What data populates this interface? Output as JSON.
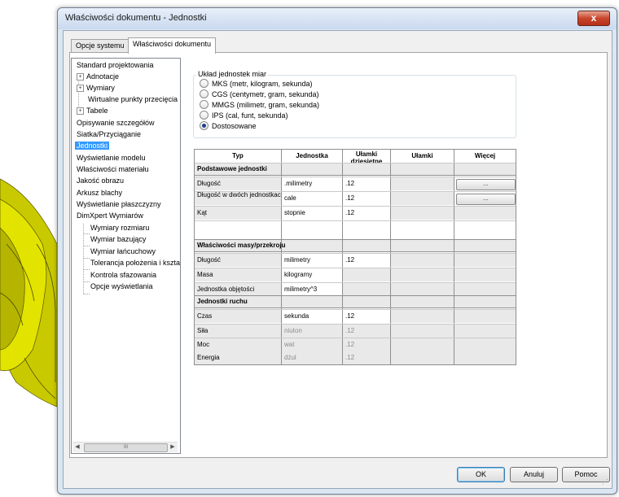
{
  "window": {
    "title": "Właściwości dokumentu - Jednostki",
    "close_label": "x"
  },
  "tabs": [
    {
      "label": "Opcje systemu"
    },
    {
      "label": "Właściwości dokumentu"
    }
  ],
  "tree": {
    "items": [
      {
        "label": "Standard projektowania"
      },
      {
        "label": "Adnotacje"
      },
      {
        "label": "Wymiary"
      },
      {
        "label": "Wirtualne punkty przecięcia"
      },
      {
        "label": "Tabele"
      },
      {
        "label": "Opisywanie szczegółów"
      },
      {
        "label": "Siatka/Przyciąganie"
      },
      {
        "label": "Jednostki"
      },
      {
        "label": "Wyświetlanie modelu"
      },
      {
        "label": "Właściwości materiału"
      },
      {
        "label": "Jakość obrazu"
      },
      {
        "label": "Arkusz blachy"
      },
      {
        "label": "Wyświetlanie płaszczyzny"
      },
      {
        "label": "DimXpert Wymiarów"
      },
      {
        "label": "Wymiary rozmiaru"
      },
      {
        "label": "Wymiar bazujący"
      },
      {
        "label": "Wymiar łańcuchowy"
      },
      {
        "label": "Tolerancja położenia i kształtu"
      },
      {
        "label": "Kontrola sfazowania"
      },
      {
        "label": "Opcje wyświetlania"
      }
    ],
    "scroll_thumb": "III"
  },
  "unit_system": {
    "title": "Układ jednostek miar",
    "options": [
      {
        "label": "MKS  (metr, kilogram, sekunda)"
      },
      {
        "label": "CGS  (centymetr, gram, sekunda)"
      },
      {
        "label": "MMGS  (milimetr, gram, sekunda)"
      },
      {
        "label": "IPS  (cal, funt, sekunda)"
      },
      {
        "label": "Dostosowane"
      }
    ],
    "selected": "Dostosowane"
  },
  "grid": {
    "headers": [
      "Typ",
      "Jednostka",
      "Ułamki dziesiętne",
      "Ułamki",
      "Więcej"
    ],
    "sections": [
      {
        "title": "Podstawowe jednostki",
        "rows": [
          {
            "type": "Długość",
            "unit": ".milimetry",
            "decimals": ".12",
            "more": "..."
          },
          {
            "type": "Długość w dwóch jednostkach",
            "unit": "cale",
            "decimals": ".12",
            "more": "..."
          },
          {
            "type": "Kąt",
            "unit": "stopnie",
            "decimals": ".12"
          }
        ]
      },
      {
        "title": "Właściwości masy/przekroju",
        "rows": [
          {
            "type": "Długość",
            "unit": "milimetry",
            "decimals": ".12"
          },
          {
            "type": "Masa",
            "unit": "kilogramy",
            "decimals": ""
          },
          {
            "type": "Jednostka objętości",
            "unit": "milimetry^3",
            "decimals": ""
          }
        ]
      },
      {
        "title": "Jednostki ruchu",
        "rows": [
          {
            "type": "Czas",
            "unit": "sekunda",
            "decimals": ".12"
          },
          {
            "type": "Siła",
            "unit": "niuton",
            "decimals": ".12"
          },
          {
            "type": "Moc",
            "unit": "wat",
            "decimals": ".12"
          },
          {
            "type": "Energia",
            "unit": "dżul",
            "decimals": ".12"
          }
        ]
      }
    ]
  },
  "buttons": {
    "ok": "OK",
    "cancel": "Anuluj",
    "help": "Pomoc"
  },
  "colors": {
    "selection": "#3399ff",
    "model_yellow": "#d4d400",
    "close_red": "#c9452c"
  }
}
